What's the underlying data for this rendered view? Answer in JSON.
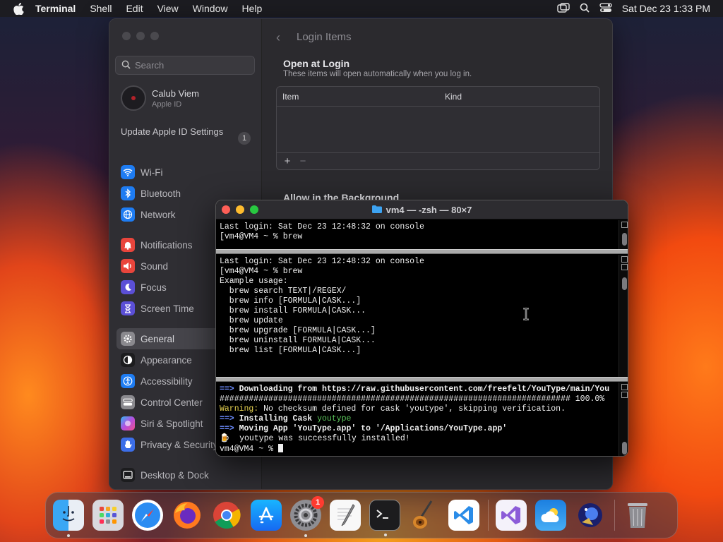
{
  "menubar": {
    "app_name": "Terminal",
    "menus": [
      "Shell",
      "Edit",
      "View",
      "Window",
      "Help"
    ],
    "clock": "Sat Dec 23  1:33 PM",
    "icons": [
      "apple-icon",
      "window-icon",
      "search-icon",
      "control-center-icon"
    ]
  },
  "settings": {
    "search_placeholder": "Search",
    "account": {
      "name": "Calub Viem",
      "subtitle": "Apple ID"
    },
    "update": {
      "label": "Update Apple ID Settings",
      "badge": "1"
    },
    "sidebar_items": [
      {
        "label": "Wi-Fi",
        "icon": "wifi-icon",
        "color": "#1e7cf2"
      },
      {
        "label": "Bluetooth",
        "icon": "bluetooth-icon",
        "color": "#1e7cf2"
      },
      {
        "label": "Network",
        "icon": "globe-icon",
        "color": "#1e7cf2"
      },
      {
        "label": "Notifications",
        "icon": "bell-icon",
        "color": "#e9453c"
      },
      {
        "label": "Sound",
        "icon": "speaker-icon",
        "color": "#e9453c"
      },
      {
        "label": "Focus",
        "icon": "moon-icon",
        "color": "#5b4fd6"
      },
      {
        "label": "Screen Time",
        "icon": "hourglass-icon",
        "color": "#5b4fd6"
      },
      {
        "label": "General",
        "icon": "gear-icon",
        "color": "#8a898e"
      },
      {
        "label": "Appearance",
        "icon": "appearance-icon",
        "color": "#1c1c1e"
      },
      {
        "label": "Accessibility",
        "icon": "accessibility-icon",
        "color": "#1e7cf2"
      },
      {
        "label": "Control Center",
        "icon": "control-center-icon",
        "color": "#8a898e"
      },
      {
        "label": "Siri & Spotlight",
        "icon": "siri-icon",
        "color": "#b44fe0"
      },
      {
        "label": "Privacy & Security",
        "icon": "hand-icon",
        "color": "#3c6ee8"
      },
      {
        "label": "Desktop & Dock",
        "icon": "dock-icon",
        "color": "#1c1c1e"
      }
    ],
    "active_item": "General",
    "page_title": "Login Items",
    "open_at_login": {
      "title": "Open at Login",
      "subtitle": "These items will open automatically when you log in.",
      "columns": [
        "Item",
        "Kind"
      ],
      "add_label": "+",
      "remove_label": "−"
    },
    "allow_background_title": "Allow in the Background"
  },
  "terminal": {
    "title": "vm4 — -zsh — 80×7",
    "pane1": [
      "Last login: Sat Dec 23 12:48:32 on console",
      "[vm4@VM4 ~ % brew"
    ],
    "pane2": [
      "Last login: Sat Dec 23 12:48:32 on console",
      "[vm4@VM4 ~ % brew",
      "Example usage:",
      "  brew search TEXT|/REGEX/",
      "  brew info [FORMULA|CASK...]",
      "  brew install FORMULA|CASK...",
      "  brew update",
      "  brew upgrade [FORMULA|CASK...]",
      "  brew uninstall FORMULA|CASK...",
      "  brew list [FORMULA|CASK...]"
    ],
    "pane3": {
      "arrow": "==>",
      "download": "Downloading from https://raw.githubusercontent.com/freefelt/YouType/main/You",
      "progress_bar": "######################################################################## 100.0%",
      "warning_label": "Warning:",
      "warning_text": " No checksum defined for cask 'youtype', skipping verification.",
      "installing_label": "Installing Cask",
      "installing_name": "youtype",
      "moving": "Moving App 'YouType.app' to '/Applications/YouType.app'",
      "success_emoji": "🍺",
      "success": "  youtype was successfully installed!",
      "prompt": "vm4@VM4 ~ % "
    }
  },
  "dock": {
    "apps": [
      {
        "name": "Finder",
        "icon": "finder-icon",
        "running": true
      },
      {
        "name": "Launchpad",
        "icon": "launchpad-icon",
        "running": false
      },
      {
        "name": "Safari",
        "icon": "safari-icon",
        "running": false
      },
      {
        "name": "Firefox",
        "icon": "firefox-icon",
        "running": false
      },
      {
        "name": "Chrome",
        "icon": "chrome-icon",
        "running": false
      },
      {
        "name": "App Store",
        "icon": "app-store-icon",
        "running": false
      },
      {
        "name": "System Settings",
        "icon": "system-settings-icon",
        "running": true,
        "badge": "1"
      },
      {
        "name": "TextEdit",
        "icon": "textedit-icon",
        "running": false
      },
      {
        "name": "Terminal",
        "icon": "terminal-icon",
        "running": true
      },
      {
        "name": "GarageBand",
        "icon": "garageband-icon",
        "running": false
      },
      {
        "name": "VS Code",
        "icon": "vscode-icon",
        "running": false
      },
      {
        "name": "Visual Studio",
        "icon": "visual-studio-icon",
        "running": false
      },
      {
        "name": "Weather",
        "icon": "weather-icon",
        "running": false
      },
      {
        "name": "Astronomy",
        "icon": "astronomy-icon",
        "running": false
      },
      {
        "name": "Trash",
        "icon": "trash-icon",
        "running": false
      }
    ]
  }
}
